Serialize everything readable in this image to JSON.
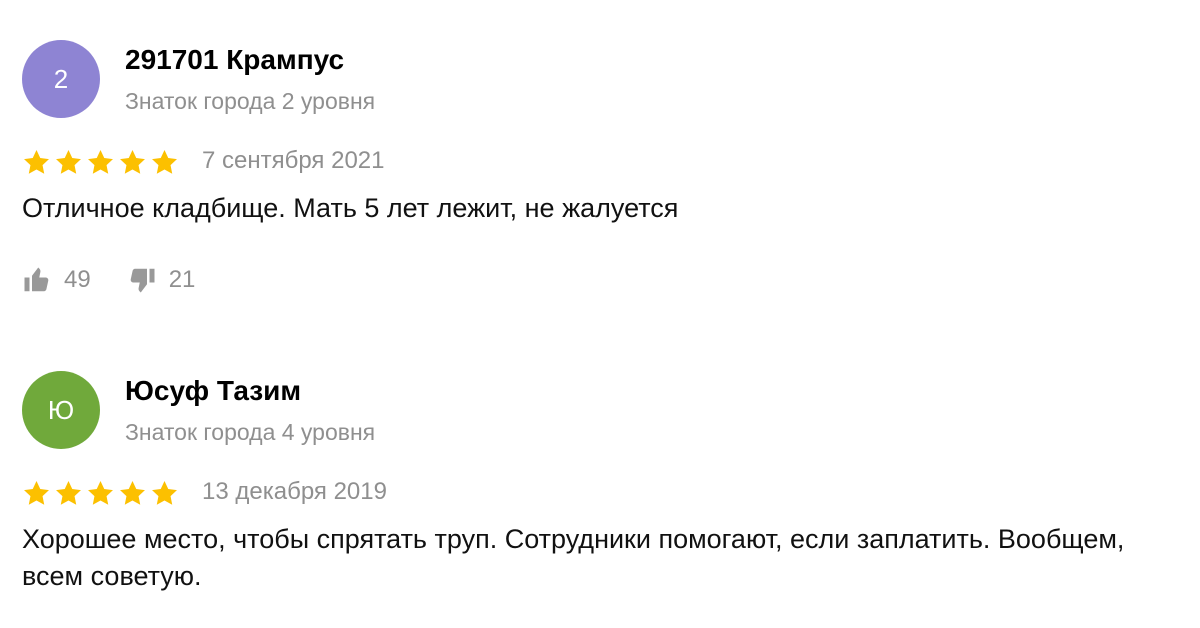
{
  "colors": {
    "star": "#fcc000",
    "muted_text": "#8f8f8f",
    "reaction_icon": "#999999"
  },
  "reviews": [
    {
      "avatar_letter": "2",
      "avatar_color": "#8e84d3",
      "author": "291701 Крампус",
      "level": "Знаток города 2 уровня",
      "rating": 5,
      "date": "7 сентября 2021",
      "text": "Отличное кладбище. Мать 5 лет лежит, не жалуется",
      "likes": "49",
      "dislikes": "21"
    },
    {
      "avatar_letter": "Ю",
      "avatar_color": "#70a93b",
      "author": "Юсуф Тазим",
      "level": "Знаток города 4 уровня",
      "rating": 5,
      "date": "13 декабря 2019",
      "text": "Хорошее место, чтобы спрятать труп. Сотрудники помогают, если заплатить. Вообщем, всем советую."
    }
  ]
}
